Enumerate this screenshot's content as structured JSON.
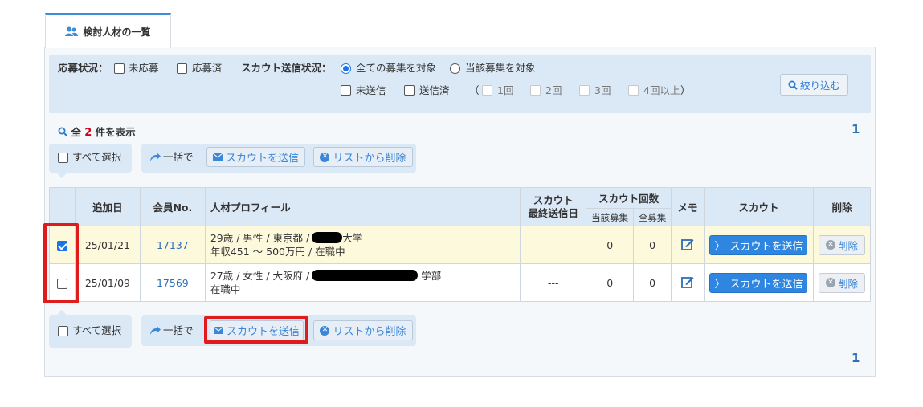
{
  "tab": {
    "label": "検討人材の一覧"
  },
  "filter": {
    "apply_status_label": "応募状況：",
    "unapplied": "未応募",
    "applied": "応募済",
    "scout_status_label": "スカウト送信状況：",
    "all_recruitment": "全ての募集を対象",
    "this_recruitment": "当該募集を対象",
    "unsent": "未送信",
    "sent": "送信済",
    "open_paren": "（",
    "once": "1回",
    "twice": "2回",
    "thrice": "3回",
    "four_plus": "4回以上",
    "close_paren": "）",
    "filter_button": "絞り込む"
  },
  "results": {
    "prefix": "全",
    "count": "2",
    "suffix": "件を表示",
    "page_top": "1",
    "page_bottom": "1"
  },
  "actions": {
    "select_all": "すべて選択",
    "bulk": "一括で",
    "send_scout": "スカウトを送信",
    "remove_from_list": "リストから削除"
  },
  "table": {
    "headers": {
      "added_date": "追加日",
      "member_no": "会員No.",
      "profile": "人材プロフィール",
      "scout_last_sent_1": "スカウト",
      "scout_last_sent_2": "最終送信日",
      "scout_count": "スカウト回数",
      "this_recruitment": "当該募集",
      "all_recruitment": "全募集",
      "memo": "メモ",
      "scout": "スカウト",
      "delete": "削除"
    },
    "rows": [
      {
        "checked": true,
        "added_date": "25/01/21",
        "member_no": "17137",
        "profile_line1_a": "29歳 / 男性 / 東京都 /",
        "profile_line1_b": "大学",
        "profile_line2": "年収451 ～ 500万円 / 在職中",
        "last_sent": "---",
        "count_this": "0",
        "count_all": "0",
        "scout_button": "スカウトを送信",
        "delete_button": "削除"
      },
      {
        "checked": false,
        "added_date": "25/01/09",
        "member_no": "17569",
        "profile_line1_a": "27歳 / 女性 / 大阪府 /",
        "profile_line1_b": "学部",
        "profile_line2": "在職中",
        "last_sent": "---",
        "count_this": "0",
        "count_all": "0",
        "scout_button": "スカウトを送信",
        "delete_button": "削除"
      }
    ]
  },
  "colors": {
    "accent": "#2f86e0",
    "highlight_row": "#fdf9dc",
    "annotation_red": "#e01b1b",
    "count_red": "#d0021b"
  }
}
